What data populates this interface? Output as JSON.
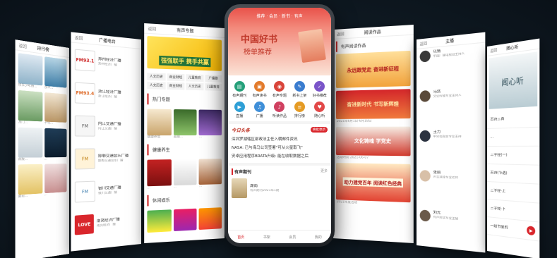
{
  "screens": {
    "rank": {
      "back": "返回",
      "title": "排行榜",
      "items": [
        {
          "name": "牧羊少年奇..."
        },
        {
          "name": "牧羊..."
        },
        {
          "name": "龙门..."
        },
        {
          "name": "千年..."
        },
        {
          "name": "新版..."
        },
        {
          "name": "..."
        },
        {
          "name": "面前..."
        },
        {
          "name": "..."
        }
      ]
    },
    "radio": {
      "back": "返回",
      "title": "广播电台",
      "items": [
        {
          "logo": "FM93.1",
          "name": "郑州经济广播",
          "sub": "郑州经济广播"
        },
        {
          "logo": "FM93.4",
          "name": "浙江经济广播",
          "sub": "浙江经济广播"
        },
        {
          "logo": "FM",
          "name": "内江交通广播",
          "sub": "内江交通广播"
        },
        {
          "logo": "FM",
          "name": "邯郸交通音乐广播",
          "sub": "邯郸交通音乐广播"
        },
        {
          "logo": "FM",
          "name": "银川交通广播",
          "sub": "银川交通广播"
        },
        {
          "logo": "LOVE",
          "name": "南充经济广播",
          "sub": "南充经济广播"
        }
      ]
    },
    "audio": {
      "back": "返回",
      "title": "有声专题",
      "banner": "强强联手 携手共赢",
      "tags": [
        "人文历史",
        "商业财经",
        "儿童教育",
        "广播剧",
        "人文历史",
        "商业财经",
        "人文历史",
        "儿童教育"
      ],
      "sec1": "热门专题",
      "sec2": "健康养生",
      "sec3": "休闲娱乐",
      "hot": [
        {
          "name": "健康养生"
        },
        {
          "name": "美丽..."
        },
        {
          "name": "..."
        }
      ],
      "health": [
        {
          "name": "..."
        },
        {
          "name": "..."
        },
        {
          "name": "..."
        }
      ]
    },
    "main": {
      "status": "推荐 · 会员 · 新书 · 有声",
      "hero1": "中国好书",
      "hero2": "榜单推荐",
      "icons": [
        {
          "name": "有声期刊",
          "glyph": "▤",
          "color": "#25a07a"
        },
        {
          "name": "有声读书",
          "glyph": "▣",
          "color": "#e37b2c"
        },
        {
          "name": "有声专题",
          "glyph": "◉",
          "color": "#d9443a"
        },
        {
          "name": "新书上架",
          "glyph": "✎",
          "color": "#3a7ccf"
        },
        {
          "name": "好书推荐",
          "glyph": "✓",
          "color": "#7a55c9"
        },
        {
          "name": "直播",
          "glyph": "▶",
          "color": "#2e9fd6"
        },
        {
          "name": "广播",
          "glyph": "♫",
          "color": "#3f8fd8"
        },
        {
          "name": "听读作品",
          "glyph": "♪",
          "color": "#d04060"
        },
        {
          "name": "排行榜",
          "glyph": "≡",
          "color": "#e59b24"
        },
        {
          "name": "随心听",
          "glyph": "♥",
          "color": "#e24848"
        }
      ],
      "news_title": "今日头条",
      "news_btn": "换批更新",
      "news": [
        "深圳罗湖辖区部政法主任入朝邮件资讯",
        "NASA: 已与海马公司签署\"可从火星取飞\"",
        "安卓应用程序BRATA升级: 能在收取数据之后"
      ],
      "mag_title": "有声期刊",
      "mag_more": "更多",
      "mag_name": "湖南",
      "mag_sub": "有声期刊2021年1期",
      "tabs": [
        "首页",
        "书架",
        "会员",
        "我的"
      ]
    },
    "works": {
      "back": "返回",
      "title": "阅读作品",
      "sec": "有声阅读作品",
      "b1": "永远跟党走 奋进新征程",
      "b2": "奋进新时代 书写新辉煌",
      "b3": "文化铸魂 学党史",
      "b4": "助力建党百年 阅读红色经典",
      "d1": "2021年6月1日-6月18日",
      "d2": "活动时间 2021-06-07",
      "d3": "2021年度活动"
    },
    "users": {
      "back": "返回",
      "title": "主播",
      "items": [
        {
          "name": "以情",
          "desc": "中国广播电视台主持人"
        },
        {
          "name": "马然",
          "desc": "文化传播专业主持人"
        },
        {
          "name": "王力",
          "desc": "中央电视台专业主持"
        },
        {
          "name": "张丽",
          "desc": "声音演绎专业老师"
        },
        {
          "name": "刘光",
          "desc": "有声阅读专业主播"
        }
      ]
    },
    "listen": {
      "back": "返回",
      "title": "随心听",
      "poem": "闻心听",
      "items": [
        "古诗三首",
        "...",
        "三字经(一)",
        "古诗(节选)",
        "三字经·上",
        "三字经·下",
        "一段书里的"
      ]
    }
  }
}
